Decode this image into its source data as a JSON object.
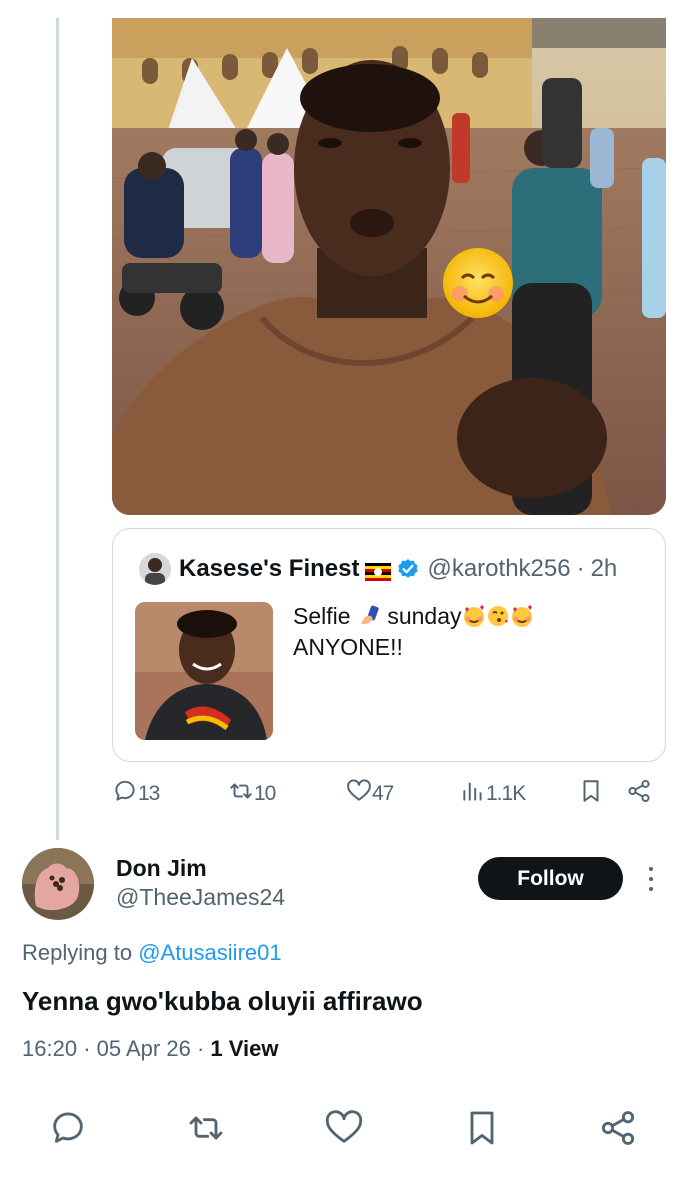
{
  "quoted": {
    "display_name": "Kasese's Finest",
    "handle": "@karothk256",
    "separator": "·",
    "time": "2h",
    "text_line1": "Selfie",
    "text_word2": "sunday",
    "text_line2": "ANYONE!!",
    "verified_color": "#1d9bf0"
  },
  "actions_top": {
    "replies": "13",
    "reposts": "10",
    "likes": "47",
    "views": "1.1K"
  },
  "reply": {
    "display_name": "Don Jim",
    "handle": "@TheeJames24",
    "follow_label": "Follow",
    "replying_prefix": "Replying to",
    "replying_to": "@Atusasiire01",
    "text": "Yenna gwo'kubba oluyii affirawo",
    "time": "16:20",
    "sep1": "·",
    "date": "05 Apr 26",
    "sep2": "·",
    "views_count": "1",
    "views_label": "View"
  },
  "icons": {
    "reply": "reply-icon",
    "repost": "repost-icon",
    "like": "heart-icon",
    "views": "views-icon",
    "bookmark": "bookmark-icon",
    "share": "share-icon",
    "more": "more-icon"
  },
  "colors": {
    "accent": "#1d9bf0",
    "text": "#0f1419",
    "secondary": "#536471",
    "border": "#cfd9de"
  }
}
